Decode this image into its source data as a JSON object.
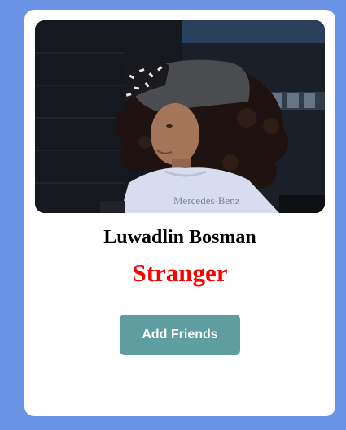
{
  "profile": {
    "name": "Luwadlin Bosman",
    "status": "Stranger",
    "photo_subject": "child-with-cap-photo"
  },
  "actions": {
    "add_friends_label": "Add Friends"
  },
  "colors": {
    "background": "#6b93e6",
    "card": "#ffffff",
    "status_text": "#ff0000",
    "button": "#5f9ea0",
    "button_text": "#ffffff"
  }
}
